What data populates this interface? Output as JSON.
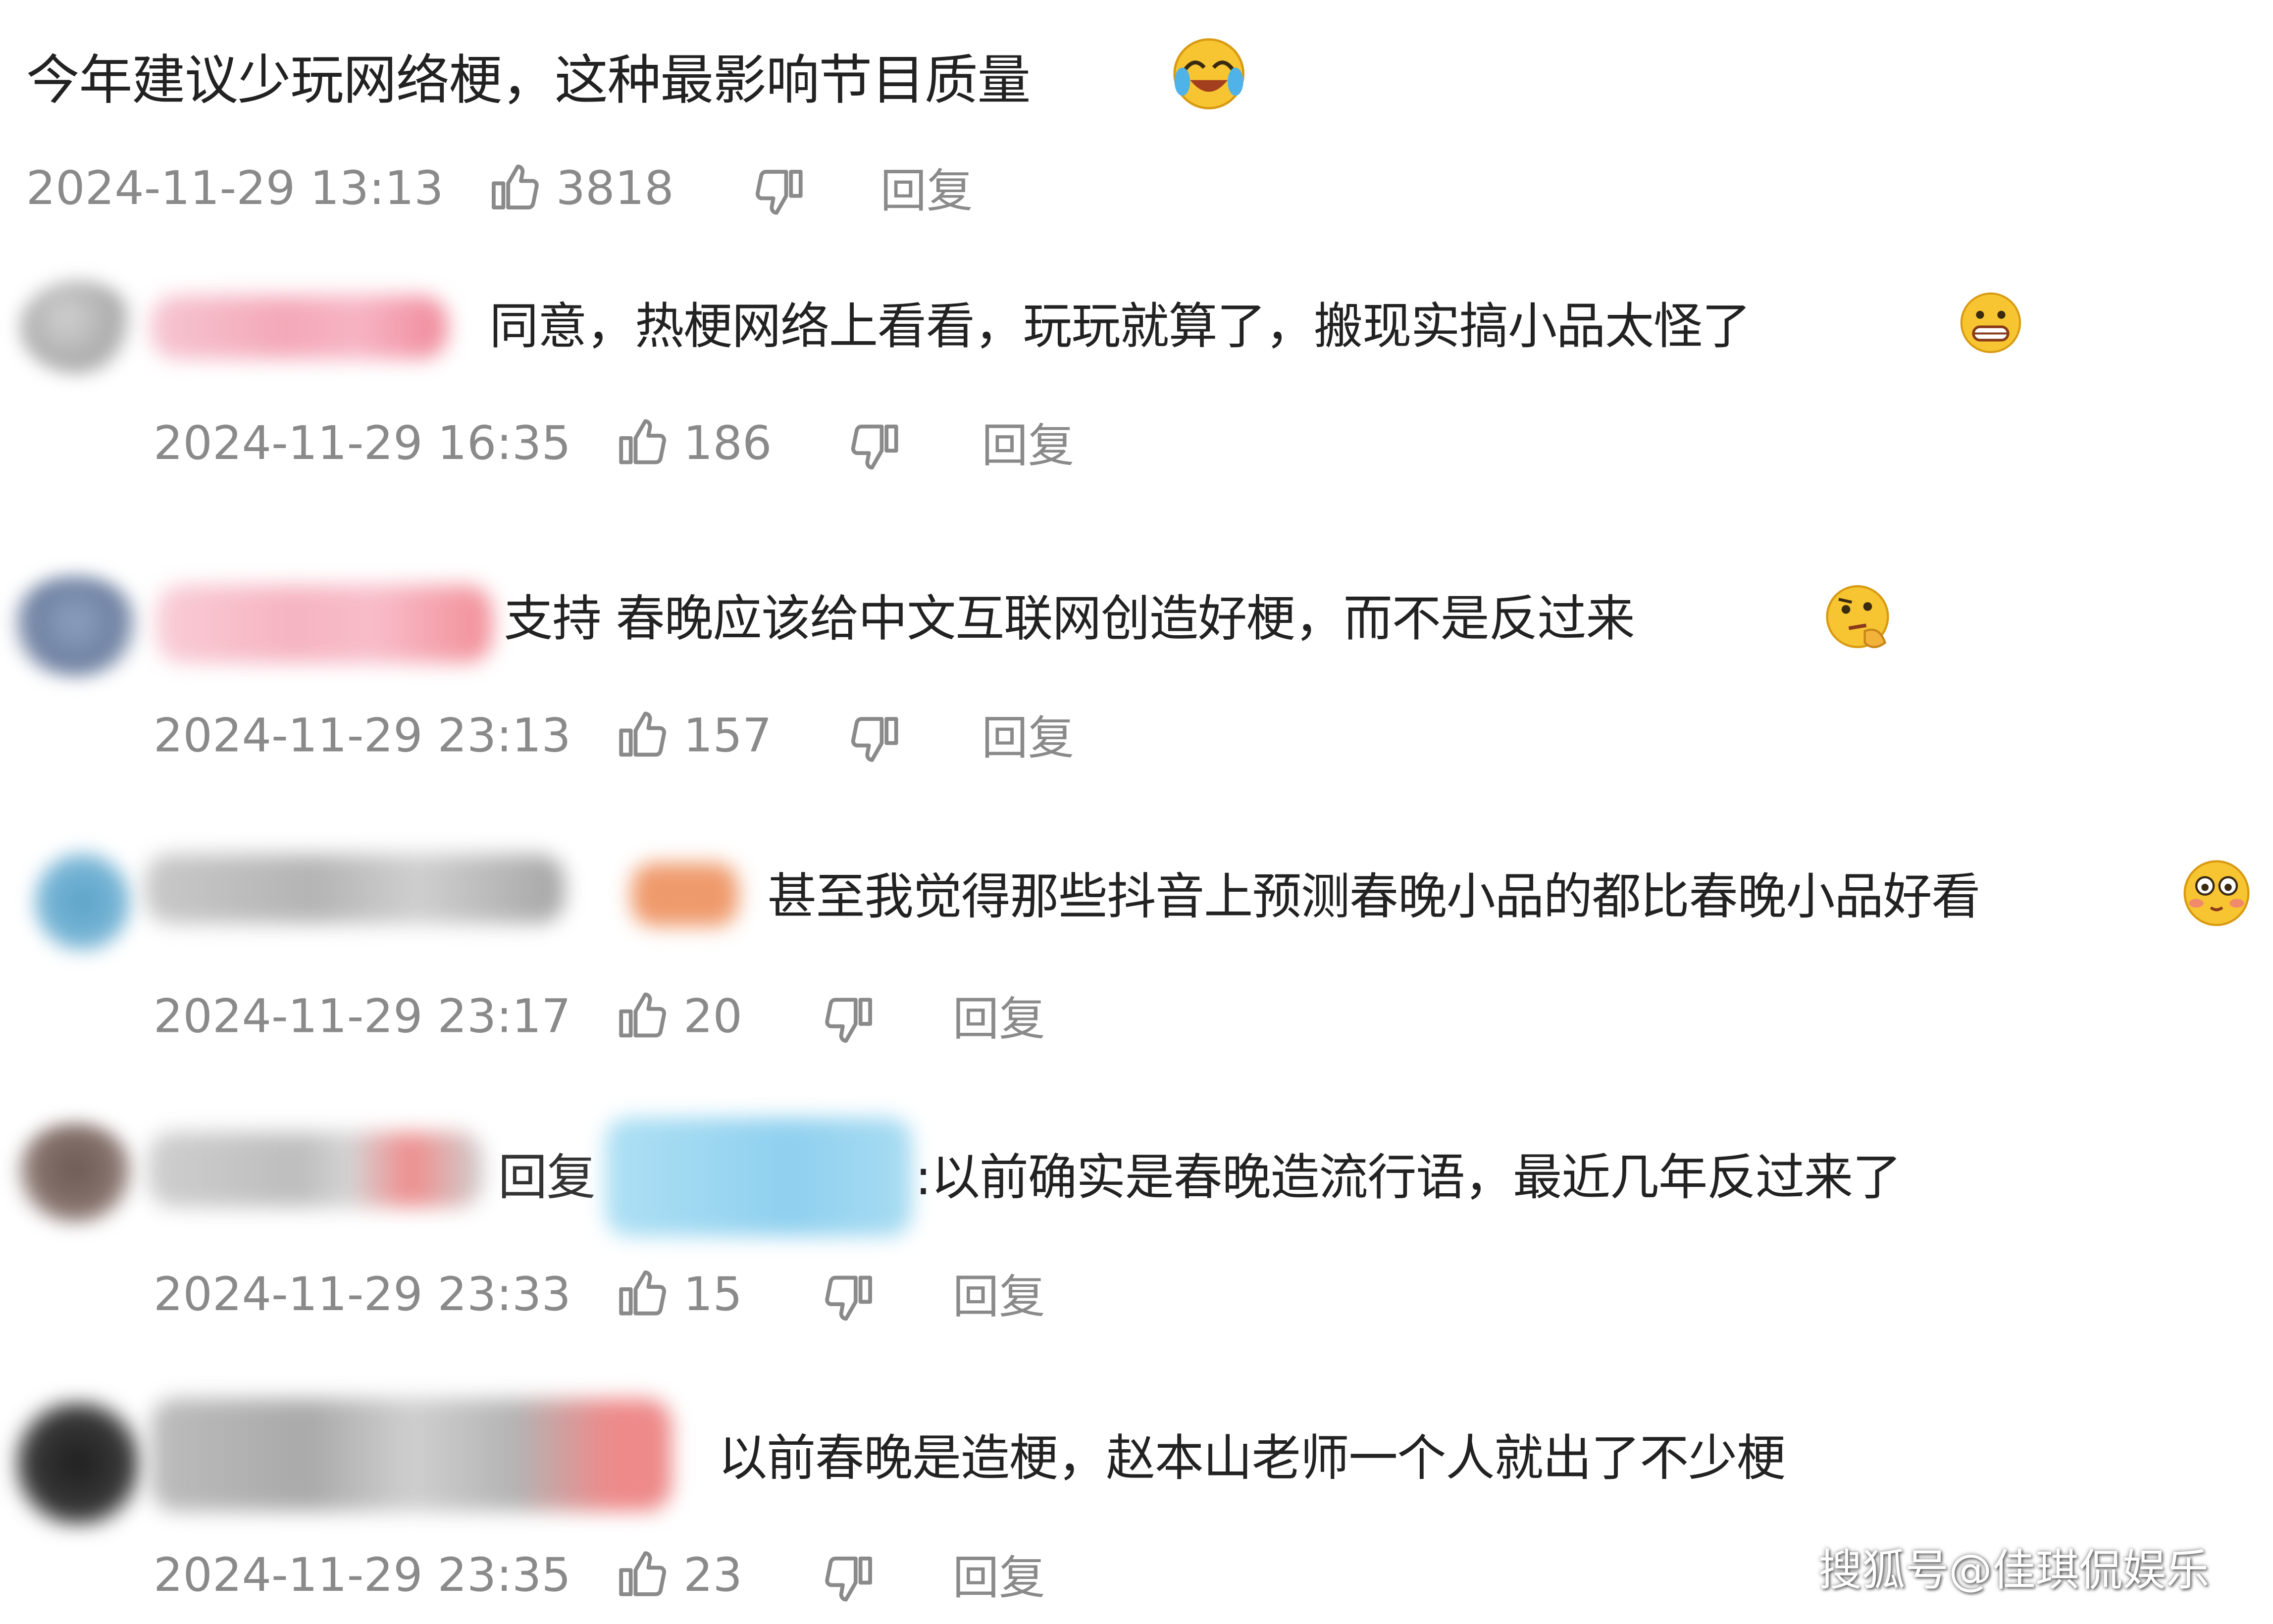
{
  "top_comment": {
    "text": "今年建议少玩网络梗，这种最影响节目质量",
    "time": "2024-11-29 13:13",
    "likes": "3818",
    "reply_label": "回复",
    "emoji": "laughing-crying-emoji"
  },
  "replies": [
    {
      "text": "同意，热梗网络上看看，玩玩就算了，搬现实搞小品太怪了",
      "time": "2024-11-29 16:35",
      "likes": "186",
      "reply_label": "回复",
      "emoji": "grimace-emoji"
    },
    {
      "text": "支持 春晚应该给中文互联网创造好梗，而不是反过来",
      "time": "2024-11-29 23:13",
      "likes": "157",
      "reply_label": "回复",
      "emoji": "thinking-emoji"
    },
    {
      "text": "甚至我觉得那些抖音上预测春晚小品的都比春晚小品好看",
      "time": "2024-11-29 23:17",
      "likes": "20",
      "reply_label": "回复",
      "emoji": "blushing-emoji"
    },
    {
      "prefix": "回复",
      "text": ":以前确实是春晚造流行语，最近几年反过来了",
      "time": "2024-11-29 23:33",
      "likes": "15",
      "reply_label": "回复"
    },
    {
      "text": "以前春晚是造梗，赵本山老师一个人就出了不少梗",
      "time": "2024-11-29 23:35",
      "likes": "23",
      "reply_label": "回复"
    }
  ],
  "watermark": "搜狐号@佳琪侃娱乐",
  "colors": {
    "meta": "#8a8a8a",
    "text": "#222222"
  }
}
